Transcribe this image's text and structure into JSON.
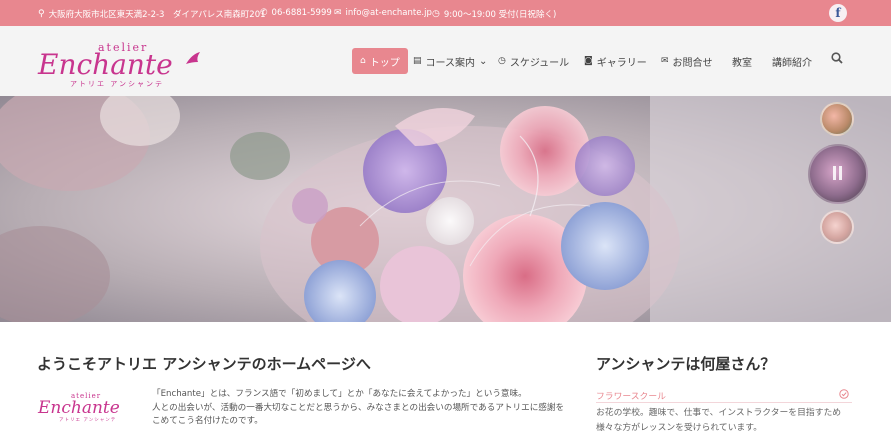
{
  "topbar": {
    "address": "大阪府大阪市北区東天満2-2-3　ダイアパレス南森町201",
    "phone": "06-6881-5999",
    "email": "info@at-enchante.jp",
    "hours": "9:00～19:00 受付(日祝除く)",
    "facebook": "f"
  },
  "logo": {
    "top": "atelier",
    "main": "Enchante",
    "sub": "アトリエ アンシャンテ"
  },
  "nav": {
    "items": [
      {
        "label": "トップ",
        "icon": "home-icon"
      },
      {
        "label": "コース案内",
        "icon": "list-icon",
        "caret": "⌄"
      },
      {
        "label": "スケジュール",
        "icon": "clock-icon"
      },
      {
        "label": "ギャラリー",
        "icon": "camera-icon"
      },
      {
        "label": "お問合せ",
        "icon": "envelope-icon"
      },
      {
        "label": "教室"
      },
      {
        "label": "講師紹介"
      }
    ]
  },
  "main": {
    "title": "ようこそアトリエ アンシャンテのホームページへ",
    "intro_lines": [
      "「Enchante」とは、フランス語で「初めまして」とか「あなたに会えてよかった」という意味。",
      "人との出会いが、活動の一番大切なことだと思うから、みなさまとの出会いの場所であるアトリエに感謝を",
      "こめてこう名付けたのです。"
    ]
  },
  "sidebar": {
    "title": "アンシャンテは何屋さん？",
    "link": "フラワースクール",
    "text_lines": [
      "お花の学校。趣味で、仕事で、インストラクターを目指すため",
      "様々な方がレッスンを受けられています。"
    ]
  },
  "colors": {
    "accent": "#e8878f",
    "logo": "#c8358e"
  }
}
